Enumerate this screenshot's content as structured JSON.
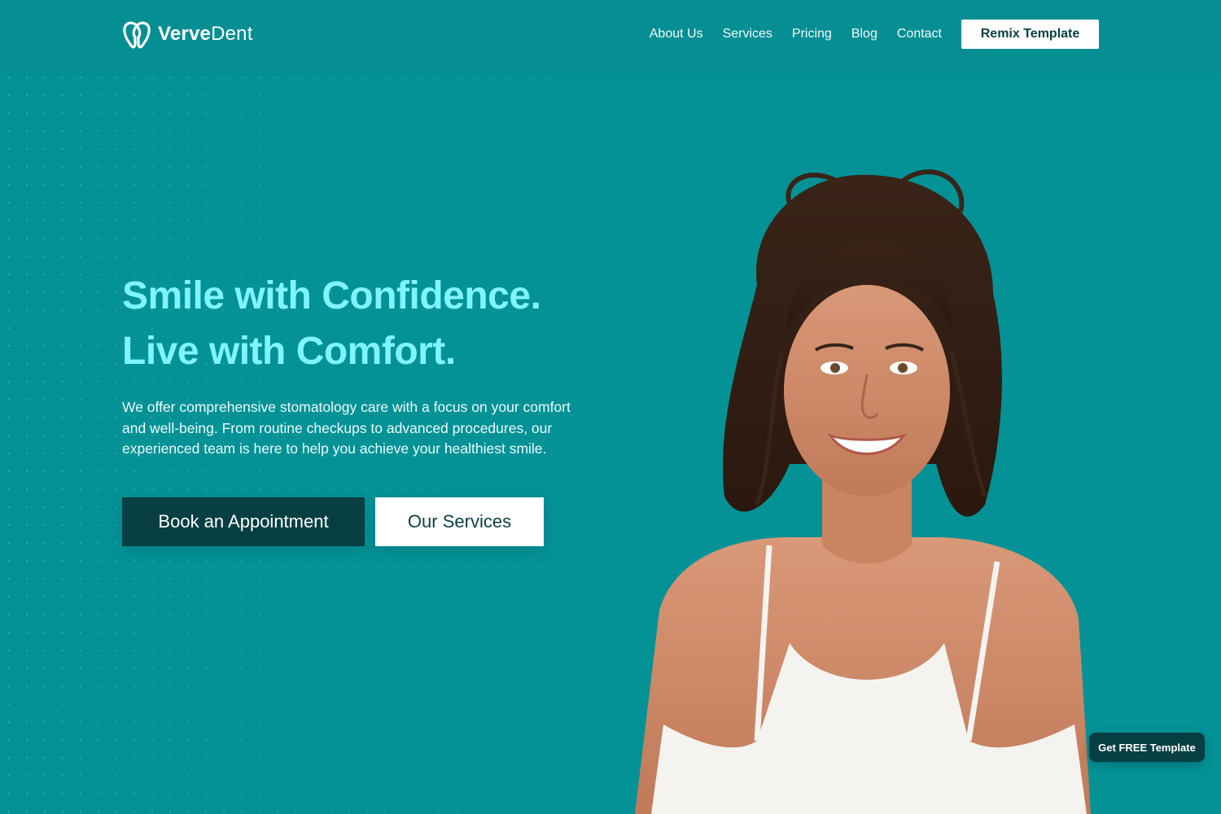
{
  "brand": {
    "name_bold": "Verve",
    "name_light": "Dent",
    "logo_icon": "tooth-icon"
  },
  "nav": {
    "items": [
      "About Us",
      "Services",
      "Pricing",
      "Blog",
      "Contact"
    ],
    "cta_label": "Remix Template"
  },
  "hero": {
    "title_line1": "Smile with Confidence.",
    "title_line2": "Live with Comfort.",
    "description": "We offer comprehensive stomatology care with a focus on your comfort and well-being. From routine checkups to advanced procedures, our experienced team is here to help you achieve your healthiest smile.",
    "primary_button": "Book an Appointment",
    "secondary_button": "Our Services"
  },
  "floating": {
    "label": "Get FREE Template"
  },
  "colors": {
    "background": "#049296",
    "accent_title": "#7ff4ff",
    "dark_button": "#073f43",
    "light_button": "#ffffff"
  }
}
